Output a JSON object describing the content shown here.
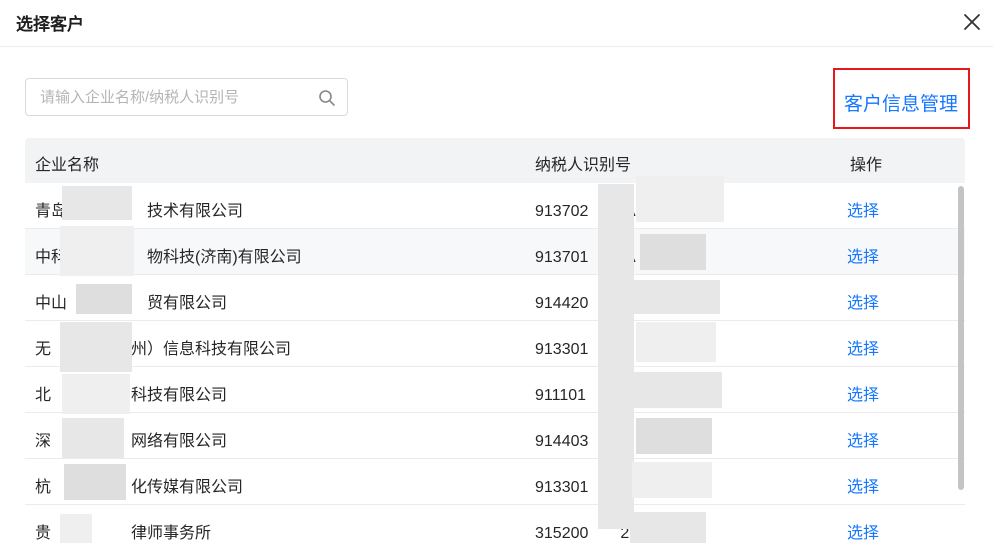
{
  "dialog": {
    "title": "选择客户",
    "close_icon": "close-icon"
  },
  "search": {
    "value": "",
    "placeholder": "请输入企业名称/纳税人识别号",
    "icon": "search-icon"
  },
  "manage_link": "客户信息管理",
  "table": {
    "columns": [
      "企业名称",
      "纳税人识别号",
      "操作"
    ],
    "rows": [
      {
        "name": "青岛　　　　　技术有限公司",
        "tax_id": "913702　　IA",
        "action": "选择"
      },
      {
        "name": "中科　　　　　物科技(济南)有限公司",
        "tax_id": "913701　　IA",
        "action": "选择"
      },
      {
        "name": "中山　　　　　贸有限公司",
        "tax_id": "914420　　A",
        "action": "选择"
      },
      {
        "name": "无　　　　　州）信息科技有限公司",
        "tax_id": "913301　　7　　3",
        "action": "选择"
      },
      {
        "name": "北　　　　　科技有限公司",
        "tax_id": "911101　　A　　H",
        "action": "选择"
      },
      {
        "name": "深　　　　　网络有限公司",
        "tax_id": "914403　　7",
        "action": "选择"
      },
      {
        "name": "杭　　　　　化传媒有限公司",
        "tax_id": "913301　　",
        "action": "选择"
      },
      {
        "name": "贵　　　　　律师事务所",
        "tax_id": "315200　　22",
        "action": "选择"
      }
    ]
  },
  "colors": {
    "link": "#1677ff",
    "highlight_border": "#e5191b",
    "header_bg": "#f2f3f5",
    "alt_row_bg": "#f7f8fa"
  }
}
